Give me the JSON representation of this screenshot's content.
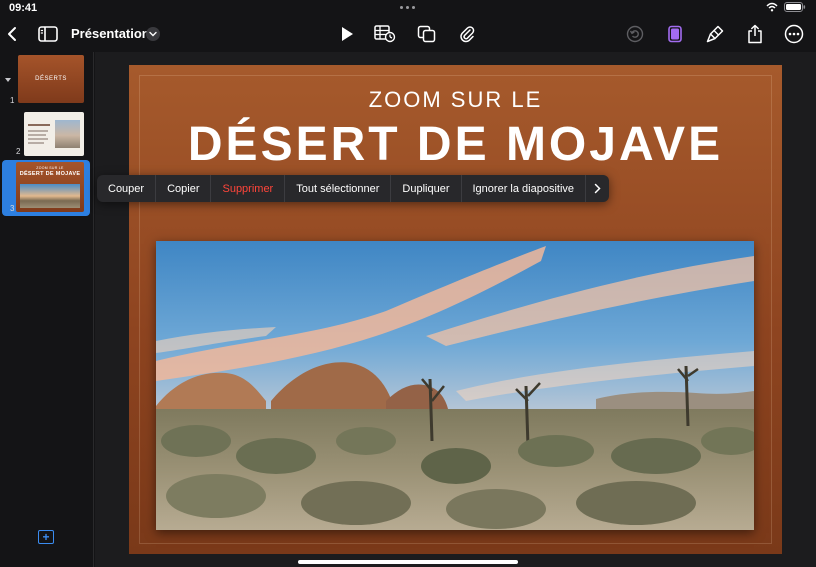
{
  "status_bar": {
    "time": "09:41"
  },
  "toolbar": {
    "document_title": "Présentation",
    "icons": [
      "back-chevron-icon",
      "sidebar-icon",
      "play-icon",
      "table-icon",
      "shapes-icon",
      "paperclip-icon",
      "undo-icon",
      "document-icon",
      "paintbrush-icon",
      "share-icon",
      "more-icon"
    ],
    "accent": "#a26cf0"
  },
  "navigator": {
    "slides": [
      {
        "number": "1",
        "thumb_text": "DÉSERTS"
      },
      {
        "number": "2",
        "thumb_text": ""
      },
      {
        "number": "3",
        "thumb_sub": "ZOOM SUR LE",
        "thumb_title": "DÉSERT DE MOJAVE"
      }
    ],
    "selected_color": "#2d7fe0"
  },
  "slide": {
    "subtitle": "ZOOM SUR LE",
    "title": "DÉSERT DE MOJAVE",
    "background": "#8e4420"
  },
  "context_menu": {
    "items": [
      "Couper",
      "Copier",
      "Supprimer",
      "Tout sélectionner",
      "Dupliquer",
      "Ignorer la diapositive"
    ],
    "destructive_color": "#ff453a"
  }
}
